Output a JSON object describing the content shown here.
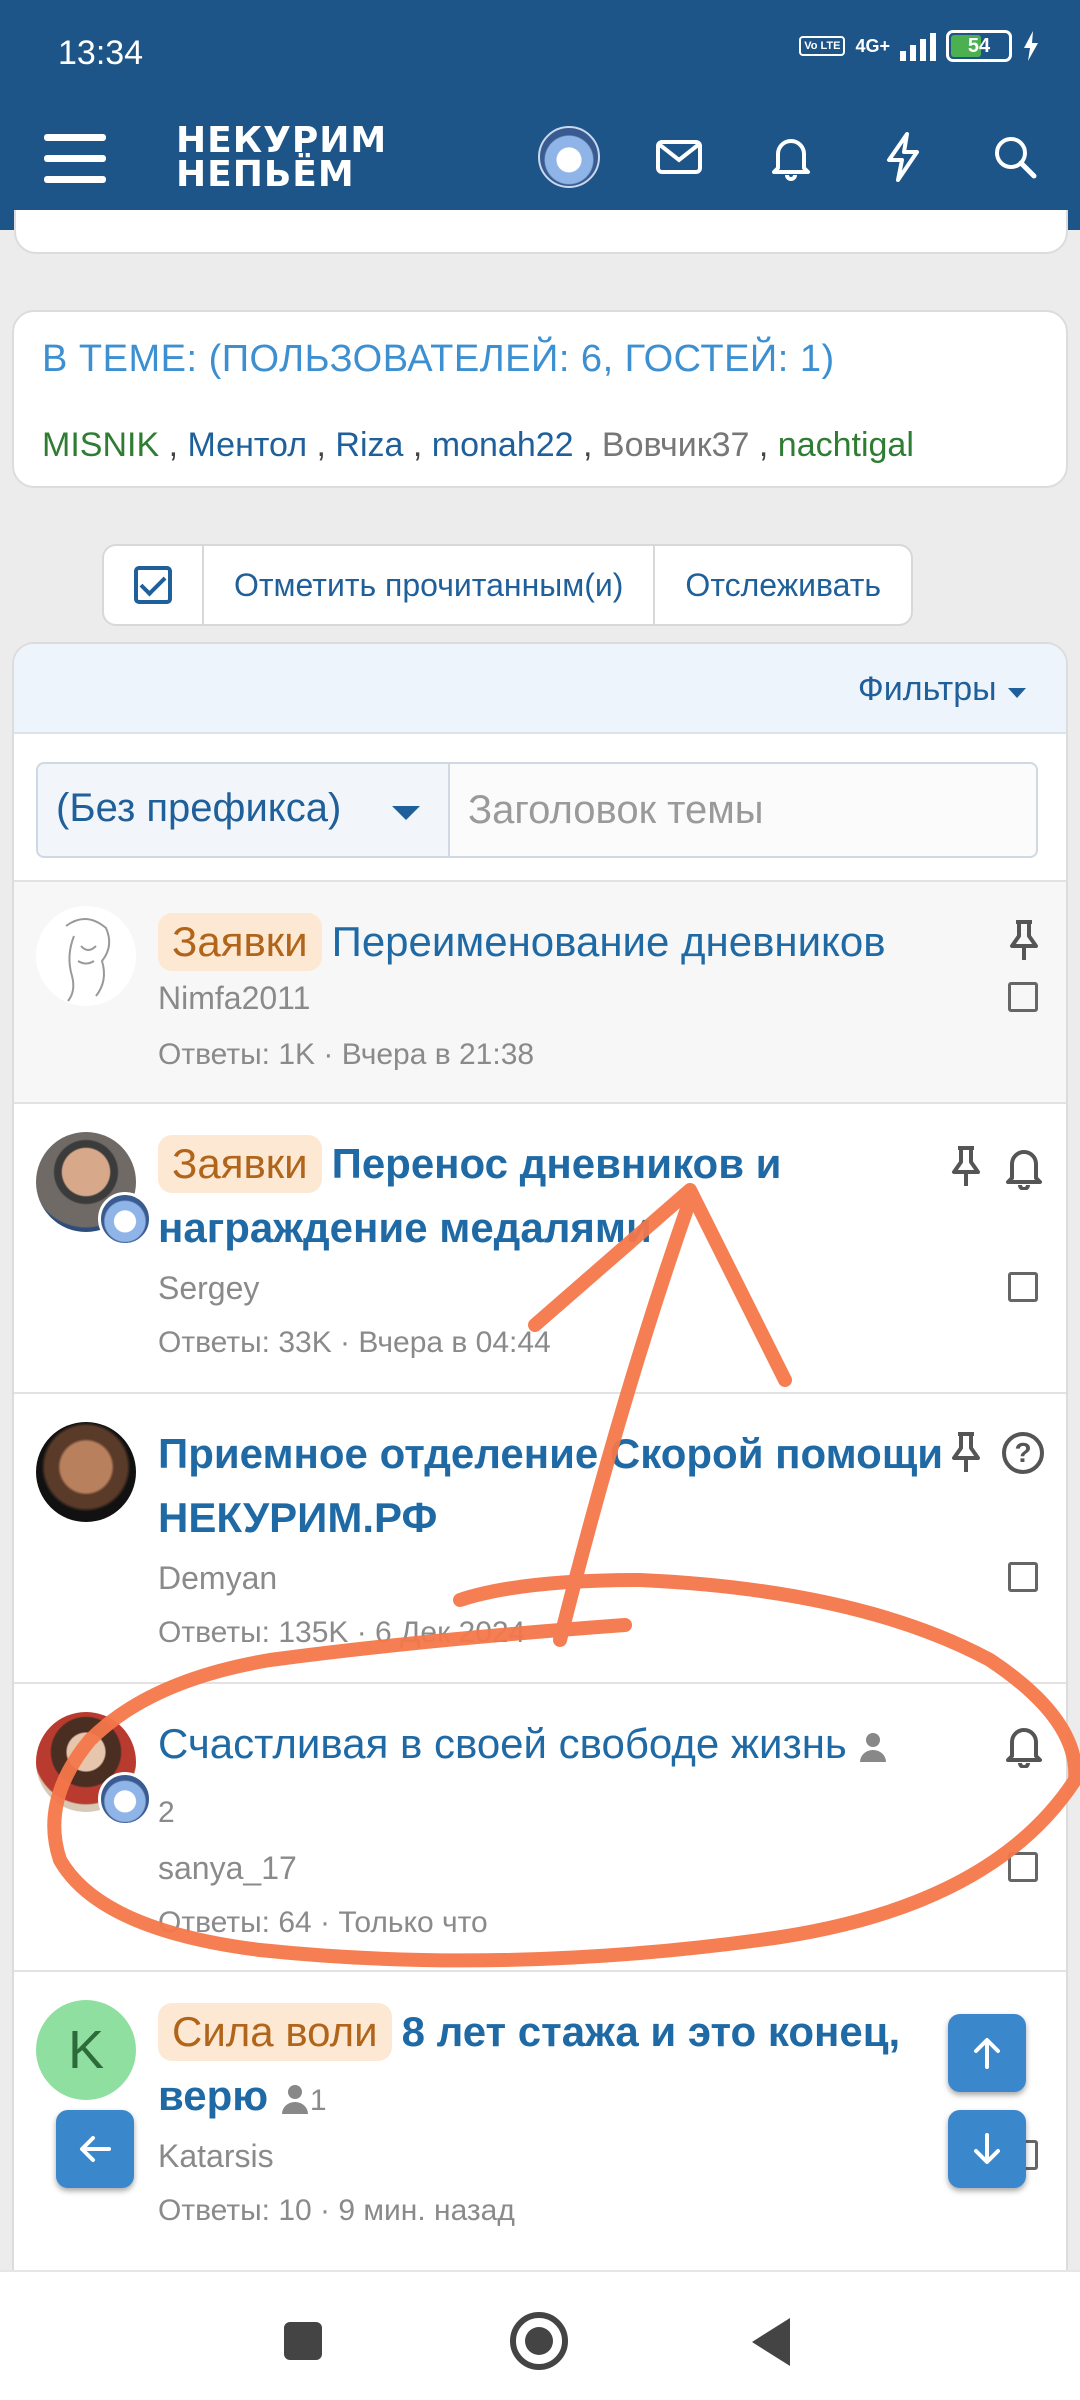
{
  "status_bar": {
    "time": "13:34",
    "network": "4G+",
    "volte": "Vo LTE",
    "battery": "54"
  },
  "header": {
    "logo_line1": "НЕКУРИМ",
    "logo_line2": "НЕПЬЁМ"
  },
  "in_thread": {
    "title": "В ТЕМЕ: (ПОЛЬЗОВАТЕЛЕЙ: 6, ГОСТЕЙ: 1)",
    "users": [
      "MISNIK",
      "Ментол",
      "Riza",
      "monah22",
      "Вовчик37",
      "nachtigal"
    ],
    "separator": " , "
  },
  "actions": {
    "mark_read": "Отметить прочитанным(и)",
    "watch": "Отслеживать"
  },
  "filters": {
    "label": "Фильтры",
    "prefix_value": "(Без префикса)",
    "title_placeholder": "Заголовок темы"
  },
  "threads": [
    {
      "prefix": "Заявки",
      "title": "Переименование дневников",
      "author": "Nimfa2011",
      "meta": "Ответы: 1K · Вчера в 21:38"
    },
    {
      "prefix": "Заявки",
      "title": "Перенос дневников и награждение медалями",
      "author": "Sergey",
      "meta": "Ответы: 33K · Вчера в 04:44"
    },
    {
      "prefix": "",
      "title": "Приемное отделение Скорой помощи НЕКУРИМ.РФ",
      "author": "Demyan",
      "meta": "Ответы: 135K · 6 Дек 2024"
    },
    {
      "prefix": "",
      "title": "Счастливая в своей свободе жизнь",
      "participants": "2",
      "author": "sanya_17",
      "meta": "Ответы: 64 · Только что"
    },
    {
      "prefix": "Сила воли",
      "title": "8 лет стажа и это конец, верю",
      "participants": "1",
      "author": "Katarsis",
      "avatar_letter": "K",
      "meta": "Ответы: 10 · 9 мин. назад"
    }
  ],
  "colors": {
    "header": "#1e5589",
    "link": "#1f6aa5",
    "prefix_bg": "#fde8d3",
    "prefix_text": "#b0651a",
    "annotation": "#f4774a"
  }
}
